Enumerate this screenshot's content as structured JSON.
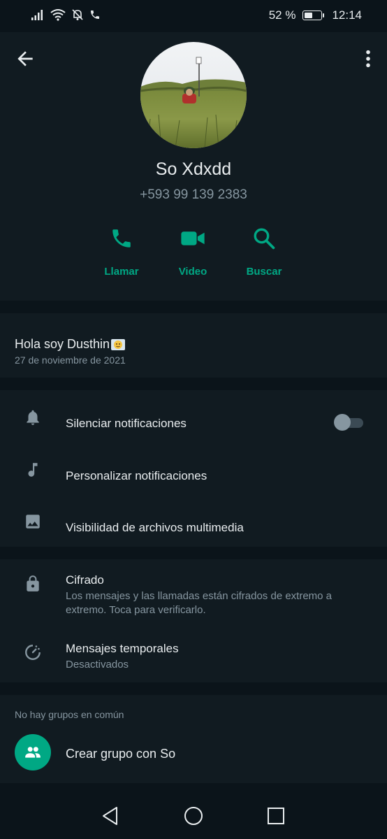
{
  "status_bar": {
    "battery_text": "52 %",
    "battery_level": 0.52,
    "time": "12:14"
  },
  "contact": {
    "name": "So Xdxdd",
    "phone": "+593 99 139 2383"
  },
  "actions": [
    {
      "label": "Llamar",
      "icon": "phone-icon"
    },
    {
      "label": "Video",
      "icon": "video-icon"
    },
    {
      "label": "Buscar",
      "icon": "search-icon"
    }
  ],
  "about": {
    "text": "Hola soy Dusthin",
    "date": "27 de noviembre de 2021"
  },
  "settings": {
    "mute": "Silenciar notificaciones",
    "mute_enabled": false,
    "custom": "Personalizar notificaciones",
    "media": "Visibilidad de archivos multimedia",
    "encryption_title": "Cifrado",
    "encryption_sub": "Los mensajes y las llamadas están cifrados de extremo a extremo. Toca para verificarlo.",
    "temp_title": "Mensajes temporales",
    "temp_sub": "Desactivados"
  },
  "groups": {
    "header": "No hay grupos en común",
    "create": "Crear grupo con So"
  },
  "colors": {
    "accent": "#00a884",
    "background": "#0b141a",
    "panel": "#111b21",
    "secondary_text": "#8696a0"
  }
}
